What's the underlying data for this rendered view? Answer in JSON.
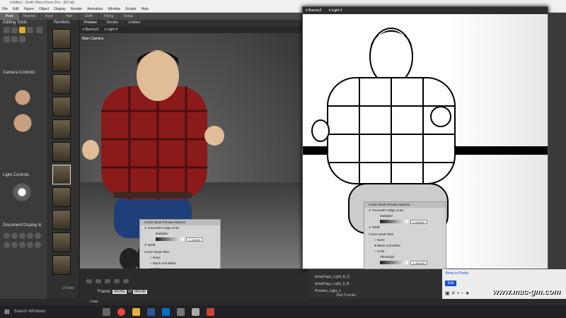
{
  "app": {
    "title": "Untitled - Smith Micro Poser Pro - [64 bit]"
  },
  "menu": [
    "File",
    "Edit",
    "Figure",
    "Object",
    "Display",
    "Render",
    "Animation",
    "Window",
    "Scripts",
    "Help"
  ],
  "rooms": [
    "Pose",
    "Material",
    "Face",
    "Hair",
    "Cloth",
    "Fitting",
    "Setup"
  ],
  "left": {
    "editing_tools": "Editing Tools",
    "camera_controls": "Camera Controls",
    "light_controls": "Light Controls",
    "document_display": "Document Display &"
  },
  "thumbs": {
    "header": "Renders"
  },
  "viewport": {
    "tabs": [
      "Preview",
      "Render",
      "Untitled"
    ],
    "figure": "Barney2",
    "light": "Light 4",
    "camera": "Main Camera"
  },
  "comic_left": {
    "title": "Comic Book Preview Options",
    "geo": "Geometric Edge Lines",
    "multiplier": "Multiplier",
    "mult_value": "1.120000",
    "weld": "Weld",
    "filter": "Comic Book Filter",
    "f_none": "None",
    "f_bw": "Black And White",
    "f_color": "Color",
    "threshold": "Threshold",
    "thr_value": "0.780000"
  },
  "comic_right": {
    "title": "Comic Book Preview Options",
    "geo": "Geometric Edge Lines",
    "multiplier": "Multiplier",
    "mult_value": "0.900000",
    "weld": "Weld",
    "filter": "Comic Book Filter",
    "f_none": "None",
    "f_bw": "Black And White",
    "f_color": "Color",
    "threshold": "Threshold",
    "thr_value": "0.460000"
  },
  "right_window": {
    "figure": "Barney2",
    "light": "Light 4"
  },
  "timeline": {
    "frame_label": "Frame:",
    "frame_cur": "00001",
    "frame_of": "of",
    "frame_total": "00030",
    "loop": "Loop",
    "skip": "Skip Frames",
    "ui_dots": "UI Dots"
  },
  "lower_mid": {
    "items": [
      "tempFlags_Light_8_G",
      "tempFlags_Light_8_B",
      "Preview_Light_1"
    ],
    "vals": [
      "1.000",
      "1.000"
    ]
  },
  "lower_right": {
    "link1": "Show in Finder",
    "edit": "Edit"
  },
  "taskbar": {
    "search": "Search Windows"
  },
  "watermark": "www.mac-gm.com"
}
